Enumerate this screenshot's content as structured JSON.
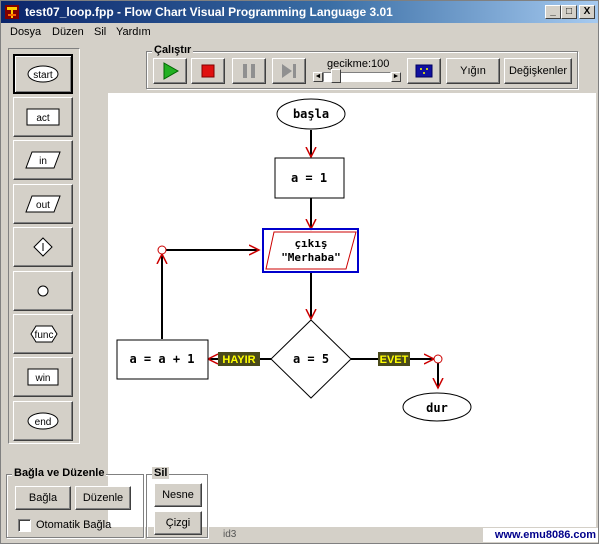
{
  "window": {
    "title": "test07_loop.fpp - Flow Chart Visual Programming Language 3.01",
    "controls": {
      "minimize": "_",
      "maximize": "□",
      "close": "X"
    }
  },
  "menu": [
    "Dosya",
    "Düzen",
    "Sil",
    "Yardım"
  ],
  "palette": [
    {
      "name": "start",
      "label": "start",
      "shape": "ellipse",
      "selected": true
    },
    {
      "name": "act",
      "label": "act",
      "shape": "rect"
    },
    {
      "name": "in",
      "label": "in",
      "shape": "parallelogram"
    },
    {
      "name": "out",
      "label": "out",
      "shape": "parallelogram"
    },
    {
      "name": "if",
      "label": "",
      "shape": "diamond"
    },
    {
      "name": "connector",
      "label": "",
      "shape": "circle"
    },
    {
      "name": "func",
      "label": "func",
      "shape": "hexagon"
    },
    {
      "name": "win",
      "label": "win",
      "shape": "rect"
    },
    {
      "name": "end",
      "label": "end",
      "shape": "ellipse"
    }
  ],
  "run_panel": {
    "label": "Çalıştır",
    "buttons": {
      "play": "play-icon",
      "stop": "stop-icon",
      "pause": "pause-icon",
      "step": "step-icon"
    },
    "delay_label": "gecikme:100",
    "delay_value": 100,
    "stack_button": "Yığın",
    "variables_button": "Değişkenler"
  },
  "connect_panel": {
    "label": "Bağla ve Düzenle",
    "connect_button": "Bağla",
    "arrange_button": "Düzenle",
    "auto_connect_label": "Otomatik Bağla",
    "auto_connect_checked": false
  },
  "delete_panel": {
    "label": "Sil",
    "object_button": "Nesne",
    "line_button": "Çizgi"
  },
  "status": {
    "id": "id3",
    "site": "www.emu8086.com"
  },
  "flowchart": {
    "start_label": "başla",
    "assign_label": "a = 1",
    "output_line1": "çıkış",
    "output_line2": "\"Merhaba\"",
    "condition_label": "a = 5",
    "increment_label": "a = a + 1",
    "no_label": "HAYIR",
    "yes_label": "EVET",
    "end_label": "dur"
  },
  "colors": {
    "accent_red": "#cc0000",
    "selection_blue": "#0000cc",
    "branch_label_bg": "#4a4a1a",
    "branch_label_fg": "#ffff00"
  }
}
